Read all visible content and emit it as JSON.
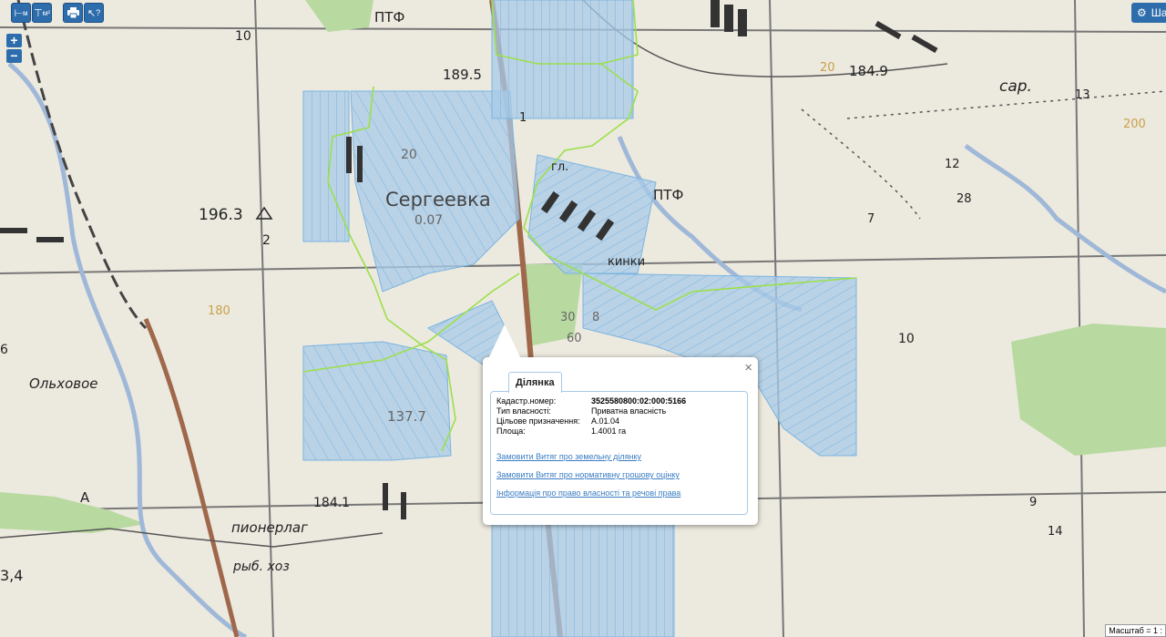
{
  "toolbar": {
    "buttons": [
      {
        "name": "measure-length-button",
        "label": "м"
      },
      {
        "name": "measure-area-button",
        "label": "м²"
      },
      {
        "name": "print-button",
        "label": ""
      },
      {
        "name": "identify-button",
        "label": "?"
      }
    ],
    "zoom_in": "+",
    "zoom_out": "−",
    "layers_label": "Шари"
  },
  "map_labels": {
    "ptf_top": "ПТФ",
    "ptf_mid": "ПТФ",
    "elev_189": "189.5",
    "elev_184_9": "184.9",
    "elev_196_3": "196.3",
    "elev_184_1": "184.1",
    "elev_3_4": "3,4",
    "village_sergeevka": "Сергеевка",
    "village_olkhovoe": "Ольховое",
    "place_pionerlag": "пионерлаг",
    "place_ryb_khoz": "рыб. хоз",
    "sar": "сар.",
    "gl": "гл.",
    "kinki": "кинки",
    "val_007": "0.07",
    "val_137_7": "137.7",
    "num_10_a": "10",
    "num_10_b": "10",
    "num_2": "2",
    "num_20": "20",
    "num_28": "28",
    "num_6": "6",
    "num_12": "12",
    "num_13": "13",
    "num_14": "14",
    "num_7": "7",
    "num_60": "60",
    "num_200": "200",
    "num_180": "180",
    "a_letter": "А",
    "num_30": "30",
    "num_8": "8",
    "num_1": "1",
    "num_9": "9",
    "num_20b": "20"
  },
  "popup": {
    "tab": "Ділянка",
    "close": "×",
    "rows": [
      {
        "key": "Кадастр.номер:",
        "value": "3525580800:02:000:5166"
      },
      {
        "key": "Тип власності:",
        "value": "Приватна власність"
      },
      {
        "key": "Цільове призначення:",
        "value": "A.01.04"
      },
      {
        "key": "Площа:",
        "value": "1.4001 га"
      }
    ],
    "links": [
      "Замовити Витяг про земельну ділянку",
      "Замовити Витяг про нормативну грошову оцінку",
      "Інформація про право власності та речові права"
    ]
  },
  "scale_label": "Масштаб = 1 :",
  "colors": {
    "parcel_fill": "#a8cbe8",
    "parcel_line": "#7ab4e0",
    "boundary": "#9be04a",
    "road": "#a0684a",
    "forest": "#b8d9a0",
    "water": "#a0b8d8",
    "toolbar": "#2e6dab"
  }
}
